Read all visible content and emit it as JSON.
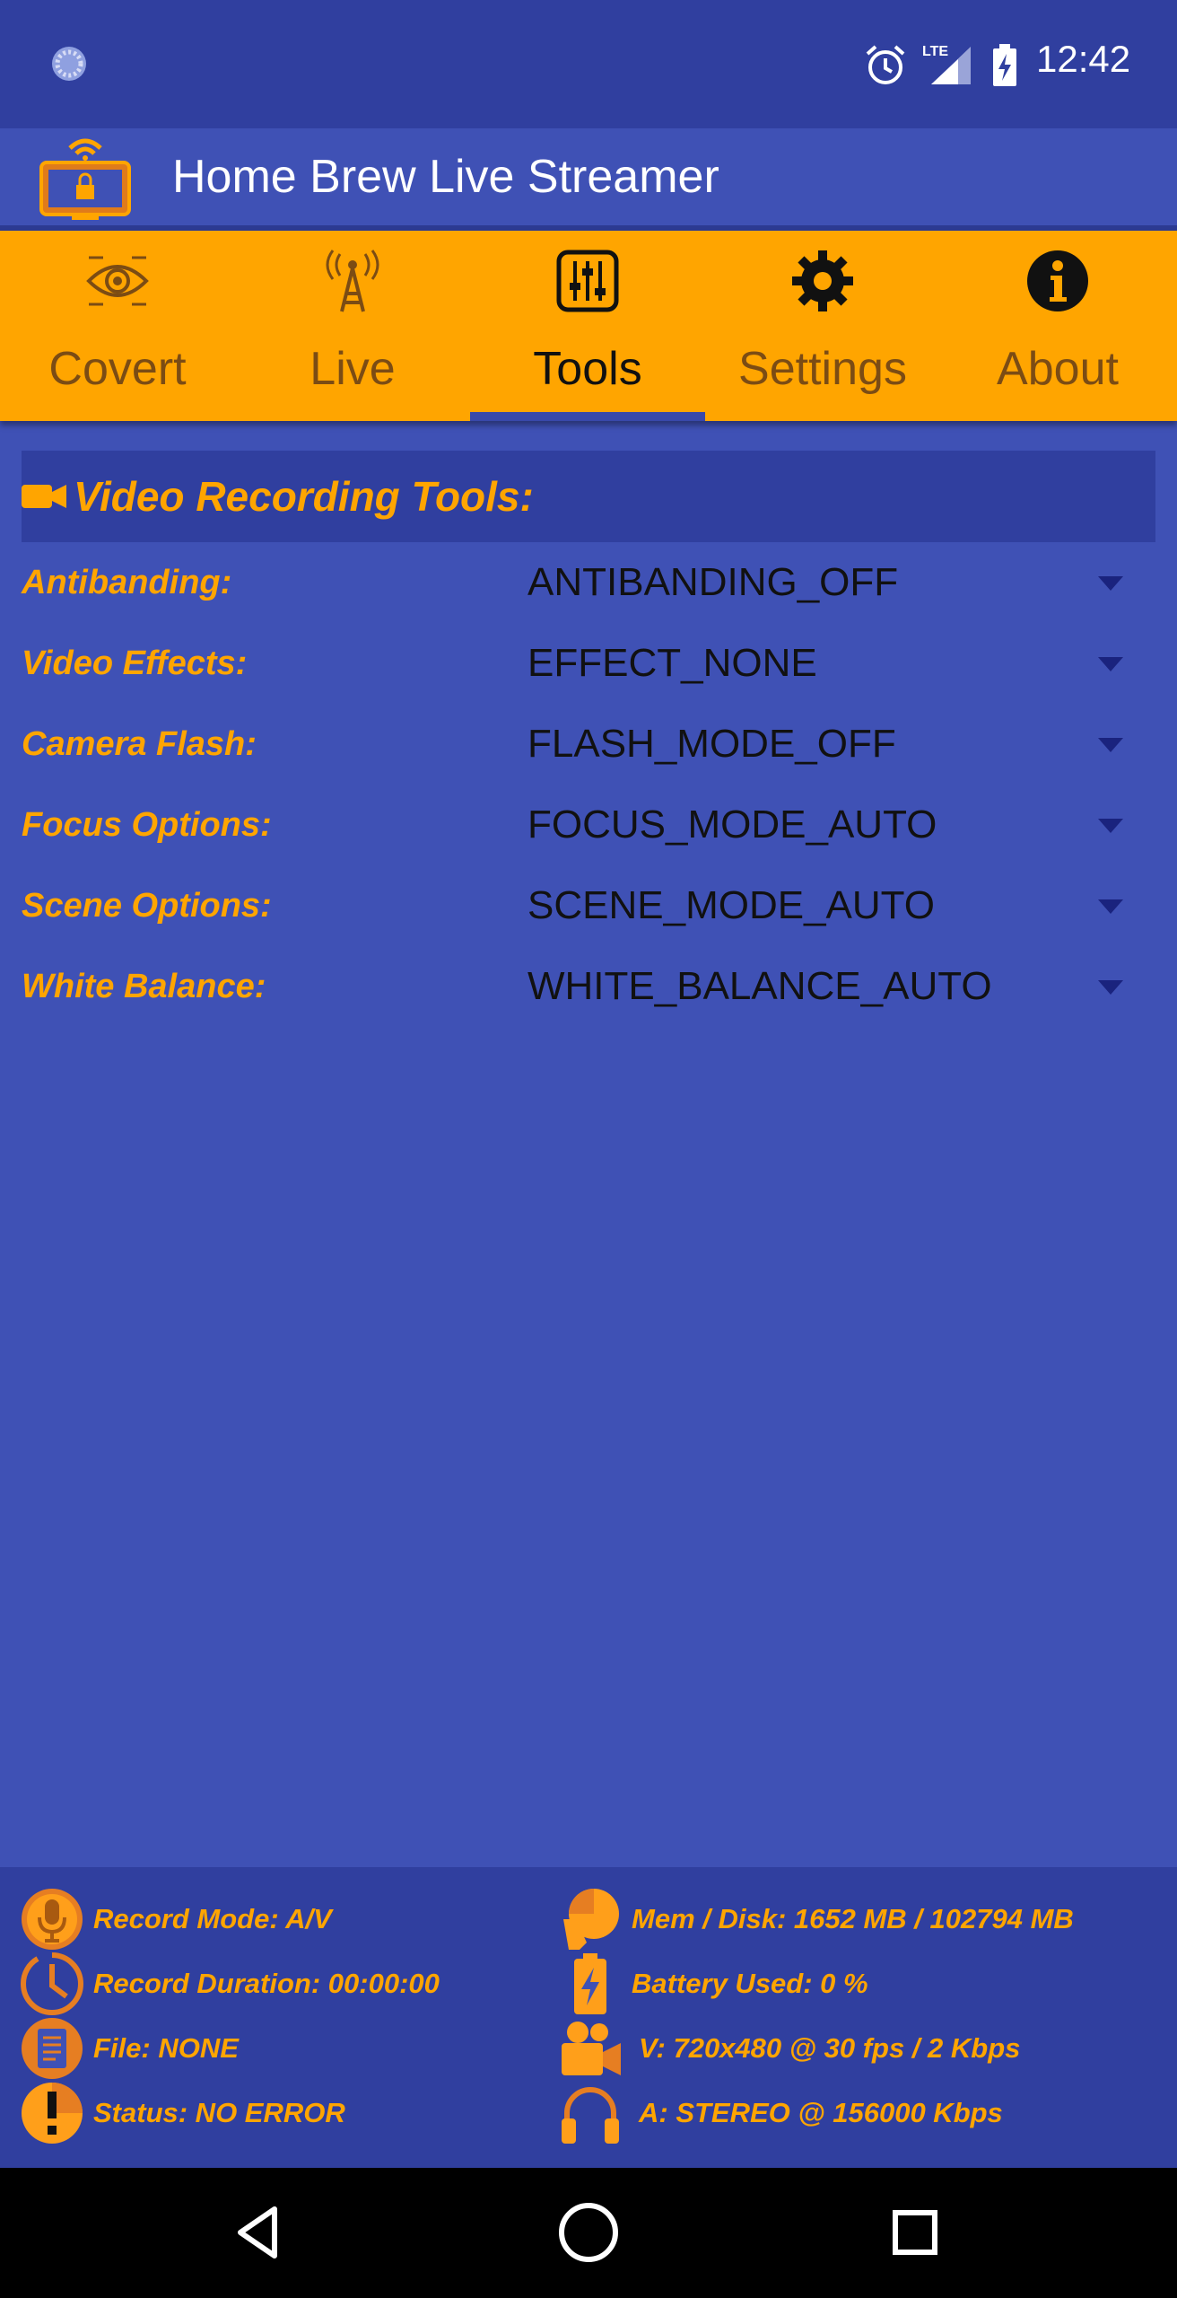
{
  "status_bar": {
    "time": "12:42",
    "icons": [
      "loading-icon",
      "alarm-icon",
      "lte-signal-icon",
      "battery-charging-icon"
    ]
  },
  "app_bar": {
    "title": "Home Brew Live Streamer",
    "logo": "monitor-lock-wifi-logo"
  },
  "tabs": [
    {
      "label": "Covert",
      "icon": "eye-icon",
      "active": false
    },
    {
      "label": "Live",
      "icon": "antenna-icon",
      "active": false
    },
    {
      "label": "Tools",
      "icon": "sliders-icon",
      "active": true
    },
    {
      "label": "Settings",
      "icon": "gear-icon",
      "active": false
    },
    {
      "label": "About",
      "icon": "info-icon",
      "active": false
    }
  ],
  "section": {
    "title": "Video Recording Tools:",
    "icon": "video-camera-icon"
  },
  "settings": [
    {
      "label": "Antibanding:",
      "value": "ANTIBANDING_OFF"
    },
    {
      "label": "Video Effects:",
      "value": "EFFECT_NONE"
    },
    {
      "label": "Camera Flash:",
      "value": "FLASH_MODE_OFF"
    },
    {
      "label": "Focus Options:",
      "value": "FOCUS_MODE_AUTO"
    },
    {
      "label": "Scene Options:",
      "value": "SCENE_MODE_AUTO"
    },
    {
      "label": "White Balance:",
      "value": "WHITE_BALANCE_AUTO"
    }
  ],
  "info_panel": {
    "left": [
      {
        "text": "Record Mode: A/V",
        "icon": "microphone-icon"
      },
      {
        "text": "Record Duration: 00:00:00",
        "icon": "clock-icon"
      },
      {
        "text": "File: NONE",
        "icon": "file-icon"
      },
      {
        "text": "Status: NO ERROR",
        "icon": "warning-icon"
      }
    ],
    "right": [
      {
        "text": "Mem / Disk: 1652 MB / 102794 MB",
        "icon": "pie-chart-icon"
      },
      {
        "text": "Battery Used: 0 %",
        "icon": "battery-icon"
      },
      {
        "text": "V: 720x480 @ 30 fps / 2 Kbps",
        "icon": "movie-camera-icon"
      },
      {
        "text": "A: STEREO @ 156000 Kbps",
        "icon": "headphones-icon"
      }
    ]
  },
  "nav_bar": {
    "buttons": [
      "back-icon",
      "home-icon",
      "recents-icon"
    ]
  },
  "colors": {
    "status_bar": "#303f9f",
    "background": "#3f51b5",
    "tab_bar": "#ffa500",
    "accent_text": "#ffa500",
    "panel": "#303f9f"
  }
}
